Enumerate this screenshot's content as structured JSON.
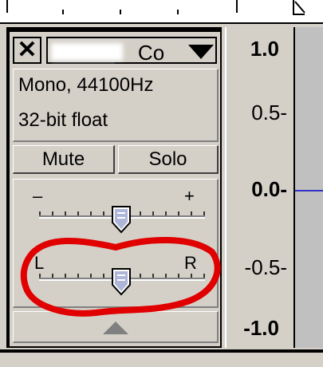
{
  "track": {
    "close_symbol": "✕",
    "name_suffix": "__Co",
    "format_line": "Mono, 44100Hz",
    "bitdepth_line": "32-bit float",
    "mute_label": "Mute",
    "solo_label": "Solo"
  },
  "gain_slider": {
    "min_label": "–",
    "max_label": "+",
    "value_fraction": 0.5
  },
  "pan_slider": {
    "left_label": "L",
    "right_label": "R",
    "value_fraction": 0.5
  },
  "scale": {
    "labels": [
      "1.0",
      "0.5-",
      "0.0-",
      "-0.5-",
      "-1.0"
    ]
  },
  "colors": {
    "panel": "#d4d0c8",
    "waveform": "#3232c8",
    "annotation": "#e00000"
  },
  "icons": {
    "close": "close-icon",
    "menu": "dropdown-arrow-icon",
    "collapse": "collapse-up-arrow-icon"
  }
}
